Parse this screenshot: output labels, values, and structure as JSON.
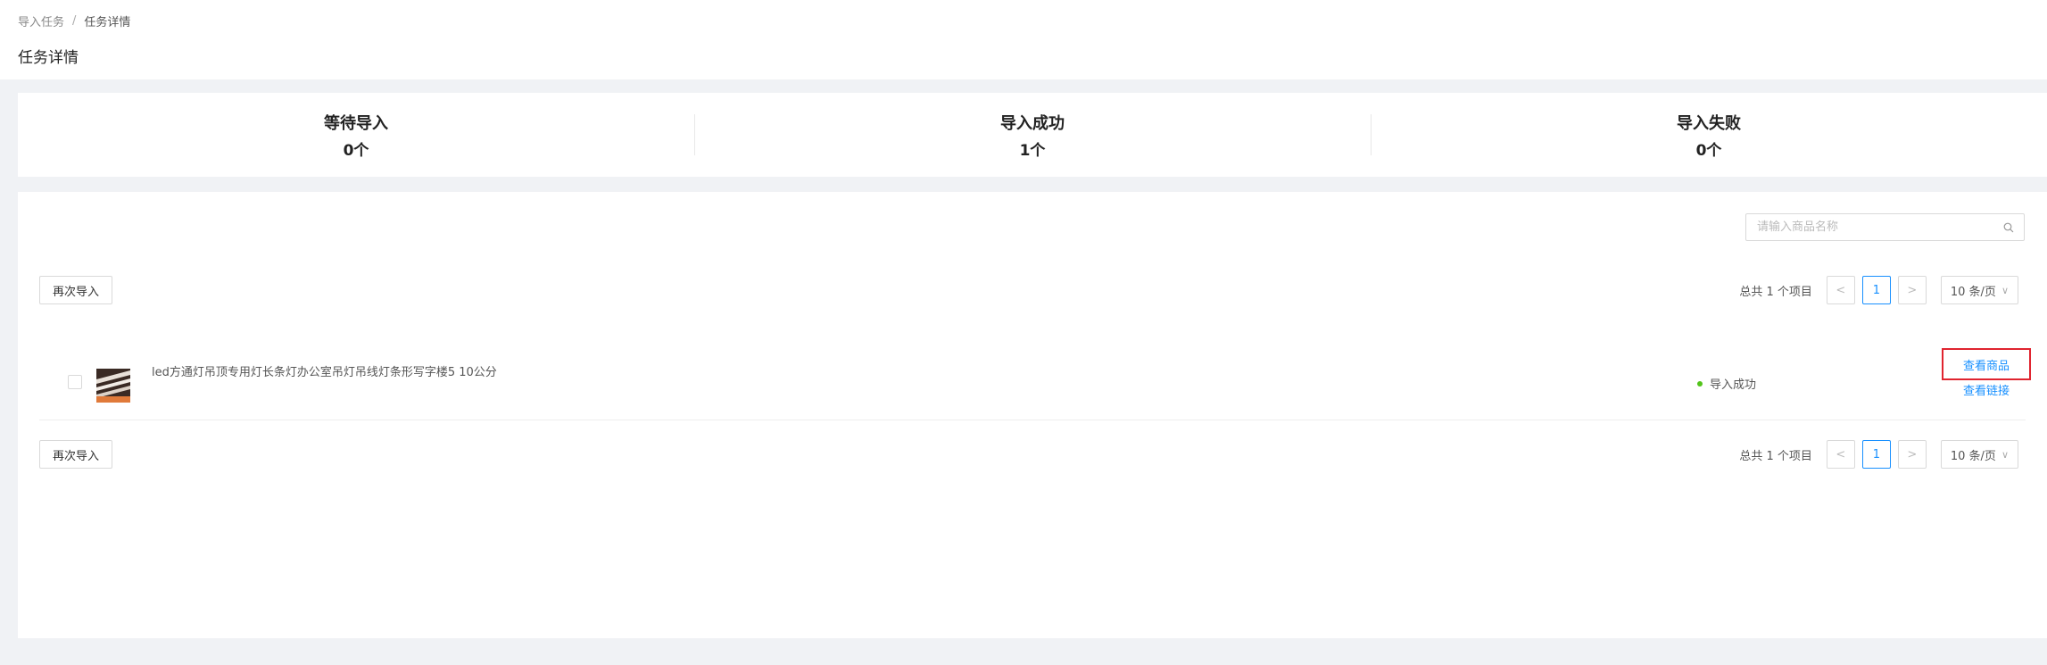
{
  "breadcrumb": {
    "parent": "导入任务",
    "separator": "/",
    "current": "任务详情"
  },
  "page": {
    "title": "任务详情"
  },
  "stats": [
    {
      "label": "等待导入",
      "value": "0个"
    },
    {
      "label": "导入成功",
      "value": "1个"
    },
    {
      "label": "导入失败",
      "value": "0个"
    }
  ],
  "search": {
    "placeholder": "请输入商品名称",
    "value": ""
  },
  "toolbar": {
    "reimport_label": "再次导入"
  },
  "pagination": {
    "total_text": "总共 1 个项目",
    "prev": "<",
    "current_page": "1",
    "next": ">",
    "page_size": "10 条/页"
  },
  "rows": [
    {
      "name": "led方通灯吊顶专用灯长条灯办公室吊灯吊线灯条形写字楼5 10公分",
      "status": "导入成功",
      "action_view": "查看商品",
      "action_link": "查看链接"
    }
  ],
  "colors": {
    "accent": "#1890ff",
    "success": "#52c41a",
    "highlight": "#e0242f"
  }
}
